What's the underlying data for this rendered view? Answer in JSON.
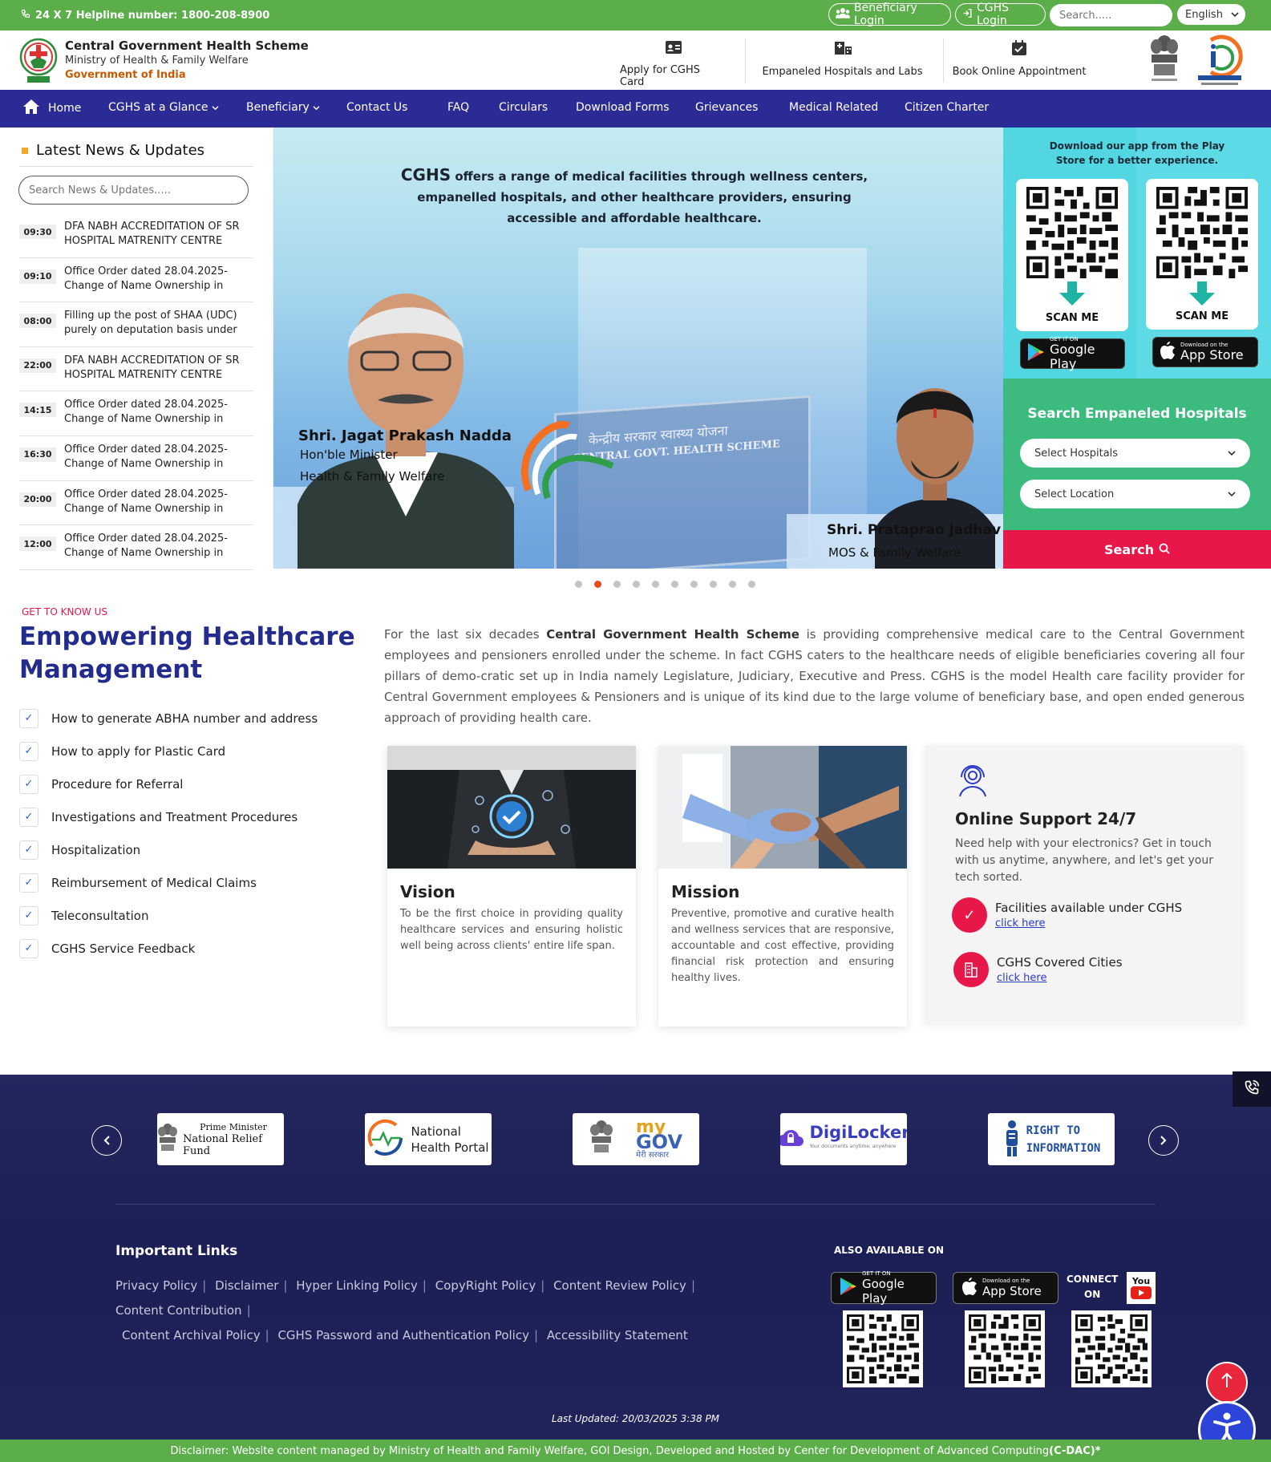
{
  "topbar": {
    "helpline": "24 X 7 Helpline number: 1800-208-8900",
    "beneficiary_login": "Beneficiary Login",
    "cghs_login": "CGHS Login",
    "search_placeholder": "Search.....",
    "language": "English"
  },
  "header": {
    "title": "Central Government Health Scheme",
    "ministry": "Ministry of Health & Family Welfare",
    "government": "Government of India",
    "quick_links": [
      {
        "label": "Apply for CGHS Card",
        "icon": "id-card-icon"
      },
      {
        "label": "Empaneled Hospitals and Labs",
        "icon": "hospital-icon"
      },
      {
        "label": "Book Online Appointment",
        "icon": "calendar-check-icon"
      }
    ]
  },
  "nav": {
    "items": [
      {
        "label": "Home"
      },
      {
        "label": "CGHS at a Glance"
      },
      {
        "label": "Beneficiary"
      },
      {
        "label": "Contact Us"
      },
      {
        "label": "FAQ"
      },
      {
        "label": "Circulars"
      },
      {
        "label": "Download Forms"
      },
      {
        "label": "Grievances"
      },
      {
        "label": "Medical Related"
      },
      {
        "label": "Citizen Charter"
      }
    ]
  },
  "news": {
    "title": "Latest News & Updates",
    "search_placeholder": "Search News & Updates.....",
    "items": [
      {
        "time": "09:30",
        "text": "DFA NABH ACCREDITATION OF SR HOSPITAL MATRENITY CENTRE"
      },
      {
        "time": "09:10",
        "text": "Office Order dated 28.04.2025- Change of Name Ownership in"
      },
      {
        "time": "08:00",
        "text": "Filling up the post of SHAA (UDC) purely on deputation basis under"
      },
      {
        "time": "22:00",
        "text": "DFA NABH ACCREDITATION OF SR HOSPITAL MATRENITY CENTRE"
      },
      {
        "time": "14:15",
        "text": "Office Order dated 28.04.2025- Change of Name Ownership in"
      },
      {
        "time": "16:30",
        "text": "Office Order dated 28.04.2025- Change of Name Ownership in"
      },
      {
        "time": "20:00",
        "text": "Office Order dated 28.04.2025- Change of Name Ownership in"
      },
      {
        "time": "12:00",
        "text": "Office Order dated 28.04.2025- Change of Name Ownership in"
      }
    ]
  },
  "banner": {
    "brand": "CGHS",
    "tagline": "offers a range of medical facilities through wellness centers, empanelled hospitals, and other healthcare providers, ensuring accessible and affordable healthcare.",
    "person1_name": "Shri. Jagat Prakash Nadda",
    "person1_role1": "Hon'ble Minister",
    "person1_role2": "Health & Family Welfare",
    "person2_name": "Shri. Prataprao Jadhav",
    "person2_role": "MOS & Family Welfare",
    "board_text1": "केन्द्रीय सरकार स्वास्थ्य योजना",
    "board_text2": "CENTRAL GOVT. HEALTH SCHEME",
    "slides_total": 10,
    "active_slide": 2
  },
  "app_panel": {
    "title": "Download our app from the Play Store for a better experience.",
    "scan_label_left": "SCAN ME",
    "scan_label_right": "SCAN ME",
    "google_small": "GET IT ON",
    "google_big": "Google Play",
    "apple_small": "Download on the",
    "apple_big": "App Store"
  },
  "hospital_search": {
    "title": "Search Empaneled Hospitals",
    "select_hospital": "Select Hospitals",
    "select_location": "Select Location",
    "button": "Search"
  },
  "about": {
    "eyebrow": "GET TO KNOW US",
    "title": "Empowering Healthcare Management",
    "para_pre": "For the last six decades ",
    "para_bold": "Central Government Health Scheme",
    "para_post": " is providing comprehensive medical care to the Central Government employees and pensioners enrolled under the scheme. In fact CGHS caters to the healthcare needs of eligible beneficiaries covering all four pillars of demo-cratic set up in India namely Legislature, Judiciary, Executive and Press. CGHS is the model Health care facility provider for Central Government employees & Pensioners and is unique of its kind due to the large volume of beneficiary base, and open ended generous approach of providing health care.",
    "checklist": [
      "How to generate ABHA number and address",
      "How to apply for Plastic Card",
      "Procedure for Referral",
      "Investigations and Treatment Procedures",
      "Hospitalization",
      "Reimbursement of Medical Claims",
      "Teleconsultation",
      "CGHS Service Feedback"
    ],
    "vision_title": "Vision",
    "vision_text": "To be the first choice in providing quality healthcare services and ensuring holistic well being across clients' entire life span.",
    "mission_title": "Mission",
    "mission_text": "Preventive, promotive and curative health and wellness services that are responsive, accountable and cost effective, providing financial risk protection and ensuring healthy lives.",
    "support_title": "Online Support 24/7",
    "support_text": "Need help with your electronics? Get in touch with us anytime, anywhere, and let's get your tech sorted.",
    "facilities_label": "Facilities available under CGHS",
    "facilities_link": "click here",
    "cities_label": "CGHS Covered Cities",
    "cities_link": "click here"
  },
  "partners": {
    "pmnrf_line1": "Prime Minister",
    "pmnrf_line2": "National Relief Fund",
    "nhp_line1": "National",
    "nhp_line2": "Health Portal",
    "mygov_my": "my",
    "mygov_gov": "GOV",
    "mygov_sub": "मेरी सरकार",
    "digilocker": "DigiLocker",
    "digilocker_sub": "Your documents anytime, anywhere",
    "rti_line1": "RIGHT TO",
    "rti_line2": "INFORMATION"
  },
  "footer": {
    "important_links_title": "Important Links",
    "links": [
      "Privacy Policy",
      "Disclaimer",
      "Hyper Linking Policy",
      "CopyRight Policy",
      "Content Review Policy",
      "Content Contribution",
      "Content Archival Policy",
      "CGHS Password and Authentication Policy",
      "Accessibility Statement"
    ],
    "also_available": "ALSO AVAILABLE ON",
    "google_small": "GET IT ON",
    "google_big": "Google Play",
    "apple_small": "Download on the",
    "apple_big": "App Store",
    "connect1": "CONNECT",
    "connect2": "ON",
    "youtube": "You",
    "last_updated": "Last Updated: 20/03/2025 3:38 PM"
  },
  "bottombar": {
    "disclaimer_pre": "Disclaimer: Website content managed by Ministry of Health and Family Welfare, GOI Design, Developed and Hosted by Center for Development of Advanced Computing ",
    "disclaimer_bold": "(C-DAC)*"
  },
  "colors": {
    "green": "#5cae4a",
    "nav_blue": "#2a2b94",
    "title_blue": "#232c8c",
    "accent_red": "#e8174a",
    "teal": "#5ddae6",
    "panel_green": "#3dbb7e",
    "footer_navy": "#1c1f55"
  }
}
